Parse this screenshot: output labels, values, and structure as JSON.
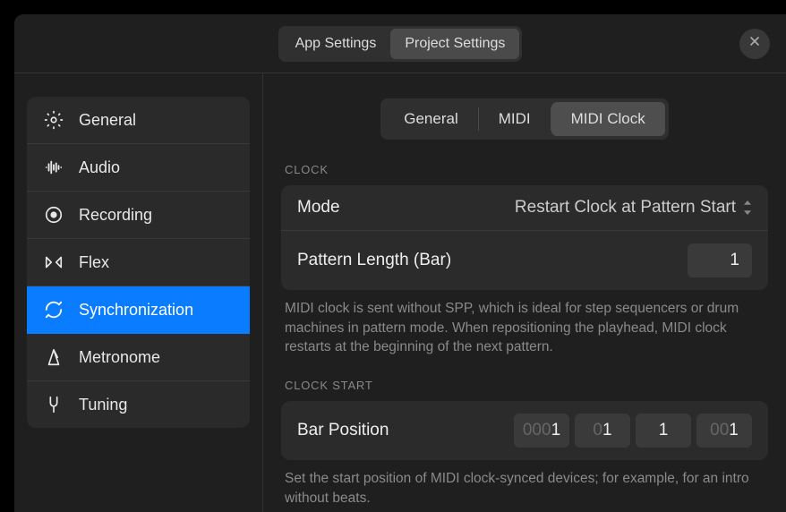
{
  "header": {
    "tabs": {
      "app": "App Settings",
      "project": "Project Settings"
    },
    "active": "project"
  },
  "sidebar": {
    "items": [
      {
        "id": "general",
        "label": "General"
      },
      {
        "id": "audio",
        "label": "Audio"
      },
      {
        "id": "recording",
        "label": "Recording"
      },
      {
        "id": "flex",
        "label": "Flex"
      },
      {
        "id": "synchronization",
        "label": "Synchronization"
      },
      {
        "id": "metronome",
        "label": "Metronome"
      },
      {
        "id": "tuning",
        "label": "Tuning"
      }
    ],
    "selected": "synchronization"
  },
  "sub_tabs": {
    "items": {
      "general": "General",
      "midi": "MIDI",
      "midi_clock": "MIDI Clock"
    },
    "active": "midi_clock"
  },
  "sections": {
    "clock": {
      "header": "CLOCK",
      "mode_label": "Mode",
      "mode_value": "Restart Clock at Pattern Start",
      "pattern_length_label": "Pattern Length (Bar)",
      "pattern_length_value": "1",
      "help": "MIDI clock is sent without SPP, which is ideal for step sequencers or drum machines in pattern mode. When repositioning the playhead, MIDI clock restarts at the beginning of the next pattern."
    },
    "clock_start": {
      "header": "CLOCK START",
      "bar_position_label": "Bar Position",
      "fields": {
        "f1_leading": "000",
        "f1_val": "1",
        "f2_leading": "0",
        "f2_val": "1",
        "f3_leading": "",
        "f3_val": "1",
        "f4_leading": "00",
        "f4_val": "1"
      },
      "help": "Set the start position of MIDI clock-synced devices; for example, for an intro without beats."
    }
  }
}
